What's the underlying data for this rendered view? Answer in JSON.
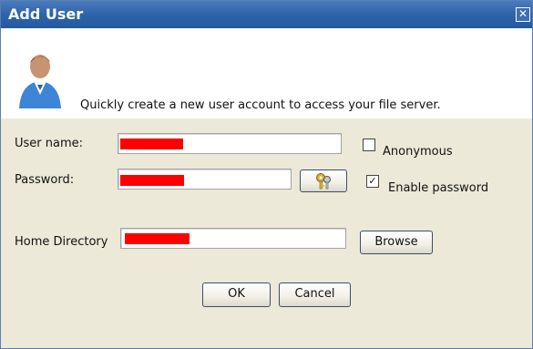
{
  "dialog": {
    "title": "Add User",
    "close_label": "✕"
  },
  "header": {
    "description": "Quickly create a new user account to access your file server."
  },
  "form": {
    "username_label": "User name:",
    "password_label": "Password:",
    "home_directory_label": "Home Directory",
    "anonymous_label": "Anonymous",
    "anonymous_checked": false,
    "enable_password_label": "Enable password",
    "enable_password_checked": true,
    "checkmark": "✓"
  },
  "buttons": {
    "browse_label": "Browse",
    "ok_label": "OK",
    "cancel_label": "Cancel"
  },
  "icons": {
    "title_close": "close-icon",
    "avatar": "user-avatar-icon",
    "key": "keys-icon"
  },
  "colors": {
    "titlebar": "#2f63aa",
    "redaction": "#ff0000",
    "dialog_body": "#ece9d8"
  }
}
